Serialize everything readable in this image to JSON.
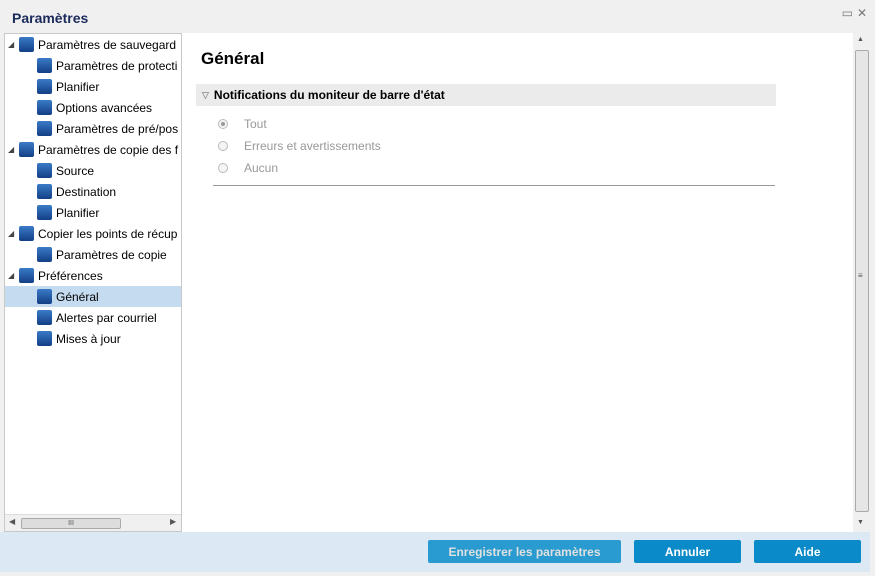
{
  "window": {
    "title": "Paramètres"
  },
  "tree": [
    {
      "label": "Paramètres de sauvegard",
      "level": 0,
      "icon": "backup-icon"
    },
    {
      "label": "Paramètres de protecti",
      "level": 1,
      "icon": "protection-icon"
    },
    {
      "label": "Planifier",
      "level": 1,
      "icon": "schedule-icon"
    },
    {
      "label": "Options avancées",
      "level": 1,
      "icon": "gears-icon"
    },
    {
      "label": "Paramètres de pré/pos",
      "level": 1,
      "icon": "wrench-icon"
    },
    {
      "label": "Paramètres de copie des f",
      "level": 0,
      "icon": "copy-icon"
    },
    {
      "label": "Source",
      "level": 1,
      "icon": "network-icon"
    },
    {
      "label": "Destination",
      "level": 1,
      "icon": "destination-icon"
    },
    {
      "label": "Planifier",
      "level": 1,
      "icon": "schedule-icon"
    },
    {
      "label": "Copier les points de récup",
      "level": 0,
      "icon": "recovery-copy-icon"
    },
    {
      "label": "Paramètres de copie",
      "level": 1,
      "icon": "protection-icon"
    },
    {
      "label": "Préférences",
      "level": 0,
      "icon": "preferences-icon"
    },
    {
      "label": "Général",
      "level": 1,
      "icon": "general-icon",
      "selected": true
    },
    {
      "label": "Alertes par courriel",
      "level": 1,
      "icon": "email-icon"
    },
    {
      "label": "Mises à jour",
      "level": 1,
      "icon": "updates-icon"
    }
  ],
  "main": {
    "title": "Général",
    "section": "Notifications du moniteur de barre d'état",
    "options": [
      {
        "label": "Tout",
        "checked": true
      },
      {
        "label": "Erreurs et avertissements",
        "checked": false
      },
      {
        "label": "Aucun",
        "checked": false
      }
    ]
  },
  "footer": {
    "save": "Enregistrer les paramètres",
    "cancel": "Annuler",
    "help": "Aide"
  },
  "colors": {
    "accent": "#0a8ac8",
    "selection": "#c5dcf0",
    "footer": "#dde8f5"
  }
}
